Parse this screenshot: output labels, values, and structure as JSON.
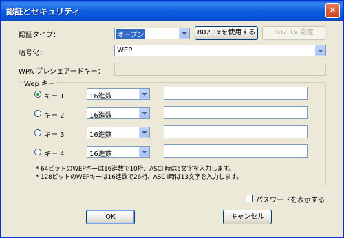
{
  "window": {
    "title": "認証とセキュリティ",
    "close_glyph": "✕"
  },
  "auth": {
    "label": "認証タイプ：",
    "value": "オープン",
    "btn_8021x": "802.1xを使用する",
    "btn_8021x_settings": "802.1x 設定"
  },
  "encryption": {
    "label": "暗号化：",
    "value": "WEP"
  },
  "wpa": {
    "label": "WPA プレシェアードキー：",
    "value": ""
  },
  "wep": {
    "group_title": "Wep キー",
    "keys": [
      {
        "label": "キー 1",
        "format": "16進数",
        "value": "",
        "selected": true
      },
      {
        "label": "キー 2",
        "format": "16進数",
        "value": "",
        "selected": false
      },
      {
        "label": "キー 3",
        "format": "16進数",
        "value": "",
        "selected": false
      },
      {
        "label": "キー 4",
        "format": "16進数",
        "value": "",
        "selected": false
      }
    ],
    "notes": [
      "* 64ビットのWEPキーは16進数で10桁、ASCII時は5文字を入力します。",
      "* 128ビットのWEPキーは16進数で26桁、ASCII時は13文字を入力します。"
    ]
  },
  "show_password": {
    "label": "パスワードを表示する",
    "checked": false
  },
  "buttons": {
    "ok": "OK",
    "cancel": "キャンセル"
  },
  "colors": {
    "title_bar": "#0a5bd8",
    "dialog_bg": "#ece9d8",
    "selection": "#316ac5",
    "radio_dot": "#21a121"
  }
}
